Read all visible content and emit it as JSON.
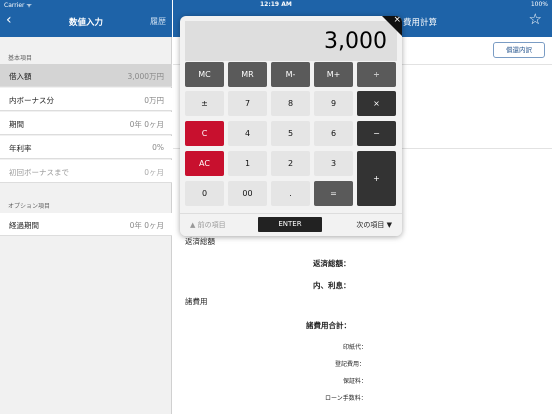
{
  "status_bar": {
    "carrier": "Carrier ᯤ",
    "time": "12:19 AM",
    "battery": "100%"
  },
  "left_panel": {
    "nav": {
      "back_icon": "‹",
      "title": "数値入力",
      "history": "履歴"
    },
    "section_basic": "基本項目",
    "rows": [
      {
        "label": "借入額",
        "value": "3,000万円"
      },
      {
        "label": "内ボーナス分",
        "value": "0万円"
      },
      {
        "label": "期間",
        "value": "0年 0ヶ月"
      },
      {
        "label": "年利率",
        "value": "0%"
      },
      {
        "label": "初回ボーナスまで",
        "value": "0ヶ月"
      }
    ],
    "section_option": "オプション項目",
    "option_rows": [
      {
        "label": "経過期間",
        "value": "0年 0ヶ月"
      }
    ]
  },
  "right_panel": {
    "nav": {
      "title": "費用計算",
      "star_icon": "☆"
    },
    "repayment_button": "償還内訳",
    "total_repayment_section": "返済総額",
    "total_repayment_label": "返済総額：",
    "interest_label": "内、利息：",
    "expenses_section": "諸費用",
    "expenses_total_label": "諸費用合計：",
    "expense_items": [
      "印紙代：",
      "登記費用：",
      "保証料：",
      "ローン手数料："
    ]
  },
  "calculator": {
    "display": "3,000",
    "close_icon": "×",
    "keys": {
      "mc": "MC",
      "mr": "MR",
      "m_minus": "M-",
      "m_plus": "M+",
      "divide": "÷",
      "plus_minus": "±",
      "seven": "7",
      "eight": "8",
      "nine": "9",
      "multiply": "×",
      "clear": "C",
      "four": "4",
      "five": "5",
      "six": "6",
      "minus": "−",
      "all_clear": "AC",
      "one": "1",
      "two": "2",
      "three": "3",
      "plus": "+",
      "zero": "0",
      "double_zero": "00",
      "dot": ".",
      "equals": "="
    },
    "prev_label": "▲ 前の項目",
    "enter_label": "ENTER",
    "next_label": "次の項目 ▼"
  },
  "colors": {
    "nav_blue": "#1e63a8",
    "key_red": "#c8102e",
    "key_dark": "#5a5a5a"
  }
}
